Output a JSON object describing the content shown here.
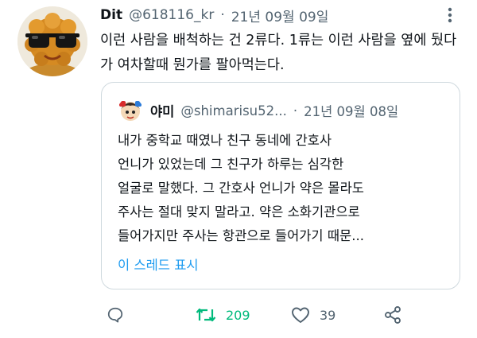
{
  "tweet": {
    "display_name": "Dit",
    "handle": "@618116_kr",
    "separator": "·",
    "date": "21년 09월 09일",
    "text": "이런 사람을 배척하는 건 2류다. 1류는 이런 사람을 옆에 뒀다가 여차할때 뭔가를 팔아먹는다."
  },
  "quote": {
    "display_name": "야미",
    "handle": "@shimarisu52...",
    "separator": "·",
    "date": "21년 09월 08일",
    "lines": [
      "내가 중학교 때였나 친구 동네에 간호사",
      "언니가 있었는데 그 친구가 하루는 심각한",
      "얼굴로 말했다. 그 간호사 언니가 약은 몰라도",
      "주사는 절대 맞지 말라고. 약은 소화기관으로",
      "들어가지만 주사는 항관으로 들어가기 때문..."
    ],
    "show_thread": "이 스레드 표시"
  },
  "actions": {
    "reply_icon": "reply-icon",
    "retweet_icon": "retweet-icon",
    "retweet_count": "209",
    "like_icon": "heart-icon",
    "like_count": "39",
    "share_icon": "share-icon"
  },
  "colors": {
    "text": "#0f1419",
    "secondary": "#536471",
    "retweet_active": "#00ba7c",
    "link": "#1d9bf0",
    "border": "#cfd9de"
  }
}
